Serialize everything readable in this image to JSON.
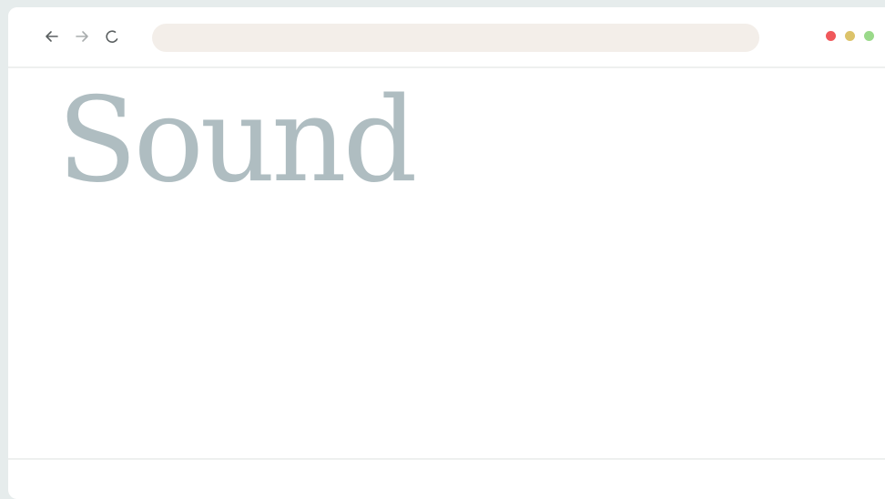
{
  "browser": {
    "address_value": "",
    "nav_icons": [
      "back-arrow-icon",
      "forward-arrow-icon",
      "reload-icon"
    ],
    "window_controls": [
      {
        "name": "close",
        "color": "#f0585b"
      },
      {
        "name": "minimize",
        "color": "#dcc36a"
      },
      {
        "name": "maximize",
        "color": "#9ad98a"
      }
    ]
  },
  "page": {
    "headline": "Sound"
  },
  "colors": {
    "headline": "#afbdc1",
    "address_bar": "#f3eee9",
    "desktop": "#e6ecec"
  }
}
